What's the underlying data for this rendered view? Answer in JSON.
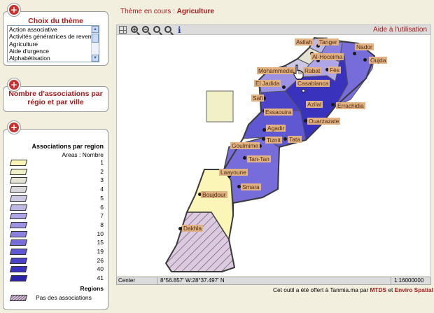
{
  "theme_panel": {
    "title": "Choix du thème",
    "options": [
      "Action associative",
      "Activités génératrices de revenus",
      "Agriculture",
      "Aide d'urgence",
      "Alphabétisation"
    ],
    "scroll_up": "▲",
    "scroll_down": "▼"
  },
  "assoc_panel": {
    "title": "Nombre d'associations par régio et par ville"
  },
  "legend": {
    "title": "Associations par region",
    "subtitle": "Areas : Nombre",
    "items": [
      {
        "label": "1",
        "color": "#fbf5b8"
      },
      {
        "label": "2",
        "color": "#f2f0c6"
      },
      {
        "label": "3",
        "color": "#e4e2d2"
      },
      {
        "label": "4",
        "color": "#d9d7dc"
      },
      {
        "label": "5",
        "color": "#ccc8e4"
      },
      {
        "label": "6",
        "color": "#beb8e8"
      },
      {
        "label": "7",
        "color": "#aea6e8"
      },
      {
        "label": "8",
        "color": "#9c93e4"
      },
      {
        "label": "10",
        "color": "#8a80e0"
      },
      {
        "label": "15",
        "color": "#766cda"
      },
      {
        "label": "19",
        "color": "#6058d2"
      },
      {
        "label": "26",
        "color": "#4c44c8"
      },
      {
        "label": "40",
        "color": "#3932bc"
      },
      {
        "label": "41",
        "color": "#2a24ad"
      }
    ],
    "regions_title": "Regions",
    "no_assoc_label": "Pas des associations"
  },
  "header": {
    "current_prefix": "Thème en cours : ",
    "current_theme": "Agriculture"
  },
  "toolbar": {
    "help_label": "Aide à l'utilisation",
    "info_glyph": "i",
    "zoom_in_glyph": "+",
    "zoom_out_glyph": "−"
  },
  "map": {
    "cities": [
      {
        "name": "Asilah",
        "label_left": true
      },
      {
        "name": "Tanger"
      },
      {
        "name": "Al-Hoceima"
      },
      {
        "name": "Nador"
      },
      {
        "name": "Oujda"
      },
      {
        "name": "Fès"
      },
      {
        "name": "Rabat"
      },
      {
        "name": "Mohammedia"
      },
      {
        "name": "Casablanca"
      },
      {
        "name": "El Jadida"
      },
      {
        "name": "Safi"
      },
      {
        "name": "Azilal"
      },
      {
        "name": "Errachidia"
      },
      {
        "name": "Essaouira"
      },
      {
        "name": "Ouarzazate"
      },
      {
        "name": "Agadir"
      },
      {
        "name": "Tiznit"
      },
      {
        "name": "Tata"
      },
      {
        "name": "Goulmime"
      },
      {
        "name": "Tan-Tan"
      },
      {
        "name": "Laayoune"
      },
      {
        "name": "Smara"
      },
      {
        "name": "Boujdour"
      },
      {
        "name": "Dakhla"
      }
    ]
  },
  "statusbar": {
    "mode": "Center",
    "coords": "8°56.857' W:28°37.497' N",
    "scale": "1:16000000"
  },
  "credit": {
    "text": "Cet outil a été offert à Tanmia.ma par ",
    "link1": "MTDS",
    "and": " et ",
    "link2": "Enviro Spatial"
  }
}
